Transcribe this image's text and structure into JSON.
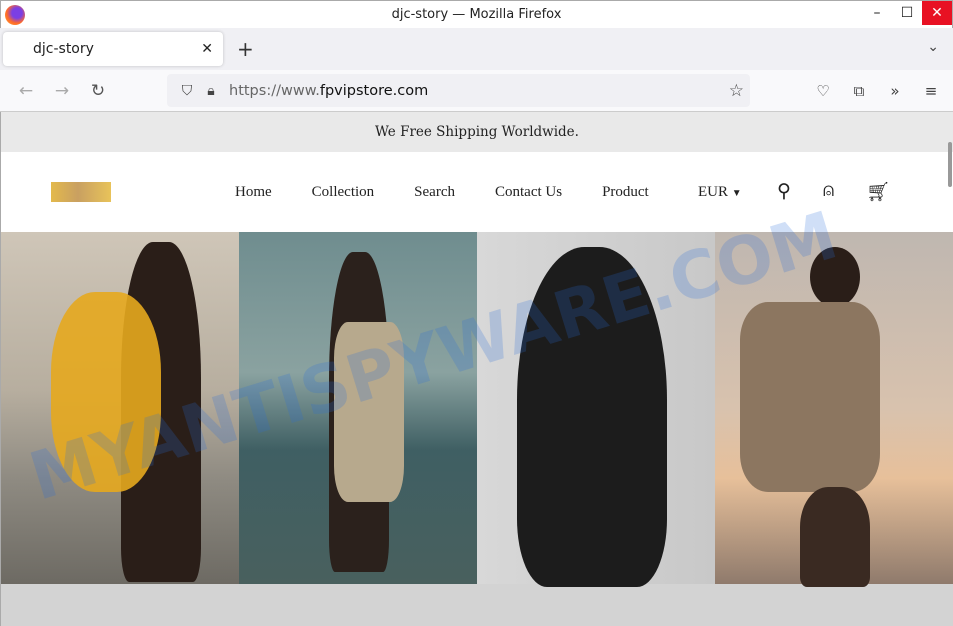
{
  "window": {
    "title": "djc-story — Mozilla Firefox"
  },
  "tabs": [
    {
      "label": "djc-story"
    }
  ],
  "url": {
    "scheme": "https://www.",
    "domain": "fpvipstore.com"
  },
  "site": {
    "announcement": "We Free Shipping Worldwide.",
    "menu": [
      "Home",
      "Collection",
      "Search",
      "Contact Us",
      "Product"
    ],
    "currency": "EUR"
  },
  "watermark": "MYANTISPYWARE.COM"
}
